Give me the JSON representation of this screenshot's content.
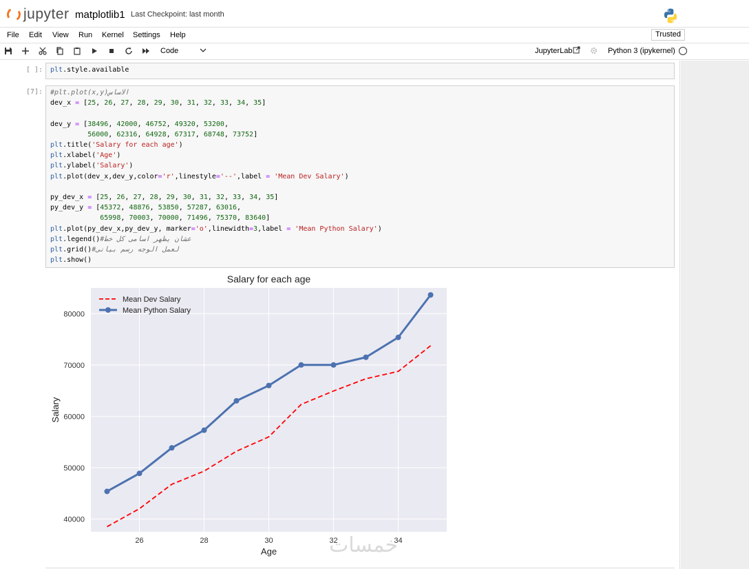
{
  "header": {
    "logo_text": "jupyter",
    "notebook_title": "matplotlib1",
    "checkpoint": "Last Checkpoint: last month"
  },
  "menubar": {
    "items": [
      "File",
      "Edit",
      "View",
      "Run",
      "Kernel",
      "Settings",
      "Help"
    ],
    "trusted": "Trusted"
  },
  "toolbar": {
    "icons": [
      "save-icon",
      "add-cell-icon",
      "cut-icon",
      "copy-icon",
      "paste-icon",
      "run-icon",
      "stop-icon",
      "restart-icon",
      "fast-forward-icon"
    ],
    "cell_type": "Code",
    "jupyterlab": "JupyterLab",
    "kernel": "Python 3 (ipykernel)"
  },
  "cells": [
    {
      "prompt": "[ ]:",
      "lines": [
        "plt.style.available"
      ]
    },
    {
      "prompt": "[7]:",
      "lines": [
        "#plt.plot(x,y)الاساس",
        "dev_x = [25, 26, 27, 28, 29, 30, 31, 32, 33, 34, 35]",
        "",
        "dev_y = [38496, 42000, 46752, 49320, 53200,",
        "         56000, 62316, 64928, 67317, 68748, 73752]",
        "plt.title('Salary for each age')",
        "plt.xlabel('Age')",
        "plt.ylabel('Salary')",
        "plt.plot(dev_x,dev_y,color='r',linestyle='--',label = 'Mean Dev Salary')",
        "",
        "py_dev_x = [25, 26, 27, 28, 29, 30, 31, 32, 33, 34, 35]",
        "py_dev_y = [45372, 48876, 53850, 57287, 63016,",
        "            65998, 70003, 70000, 71496, 75370, 83640]",
        "plt.plot(py_dev_x,py_dev_y, marker='o',linewidth=3,label = 'Mean Python Salary')",
        "plt.legend()#عشان يظهر اسامى كل خط",
        "plt.grid()#لعمل الوجه رسم بيانى",
        "plt.show()"
      ]
    }
  ],
  "watermark": "خمسات",
  "chart_data": {
    "type": "line",
    "title": "Salary for each age",
    "xlabel": "Age",
    "ylabel": "Salary",
    "xlim": [
      24.5,
      35.5
    ],
    "ylim": [
      37500,
      85000
    ],
    "xticks": [
      26,
      28,
      30,
      32,
      34
    ],
    "yticks": [
      40000,
      50000,
      60000,
      70000,
      80000
    ],
    "grid": true,
    "legend_position": "top-left",
    "series": [
      {
        "name": "Mean Dev Salary",
        "color": "#ff0000",
        "linestyle": "dashed",
        "x": [
          25,
          26,
          27,
          28,
          29,
          30,
          31,
          32,
          33,
          34,
          35
        ],
        "y": [
          38496,
          42000,
          46752,
          49320,
          53200,
          56000,
          62316,
          64928,
          67317,
          68748,
          73752
        ]
      },
      {
        "name": "Mean Python Salary",
        "color": "#4c72b0",
        "linestyle": "solid",
        "marker": "o",
        "x": [
          25,
          26,
          27,
          28,
          29,
          30,
          31,
          32,
          33,
          34,
          35
        ],
        "y": [
          45372,
          48876,
          53850,
          57287,
          63016,
          65998,
          70003,
          70000,
          71496,
          75370,
          83640
        ]
      }
    ]
  }
}
